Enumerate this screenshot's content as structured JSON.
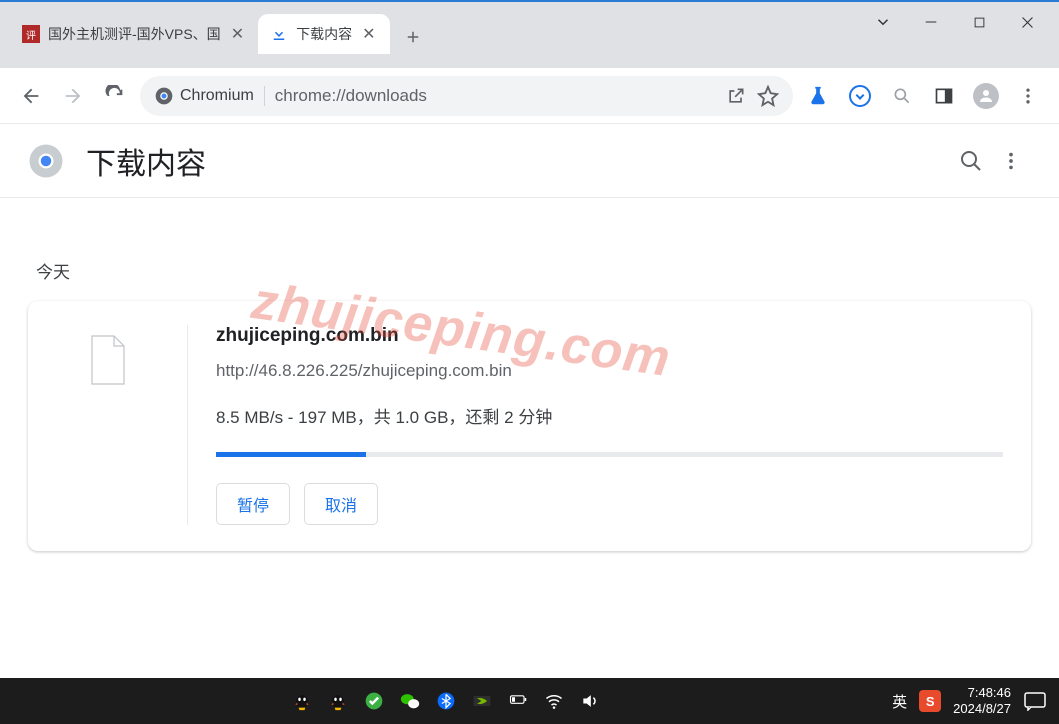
{
  "window": {
    "tabs": [
      {
        "title": "国外主机测评-国外VPS、国",
        "active": false
      },
      {
        "title": "下载内容",
        "active": true
      }
    ],
    "controls": {
      "dropdown": "⌄",
      "minimize": "—",
      "maximize": "▢",
      "close": "✕"
    }
  },
  "toolbar": {
    "browser_label": "Chromium",
    "url": "chrome://downloads"
  },
  "downloads": {
    "page_title": "下载内容",
    "date_label": "今天",
    "item": {
      "filename": "zhujiceping.com.bin",
      "source_url": "http://46.8.226.225/zhujiceping.com.bin",
      "progress_text": "8.5 MB/s - 197 MB，共 1.0 GB，还剩 2 分钟",
      "progress_percent": 19,
      "pause_label": "暂停",
      "cancel_label": "取消"
    }
  },
  "watermark": "zhujiceping.com",
  "taskbar": {
    "ime": "英",
    "sogou": "S",
    "time": "7:48:46",
    "date": "2024/8/27"
  }
}
